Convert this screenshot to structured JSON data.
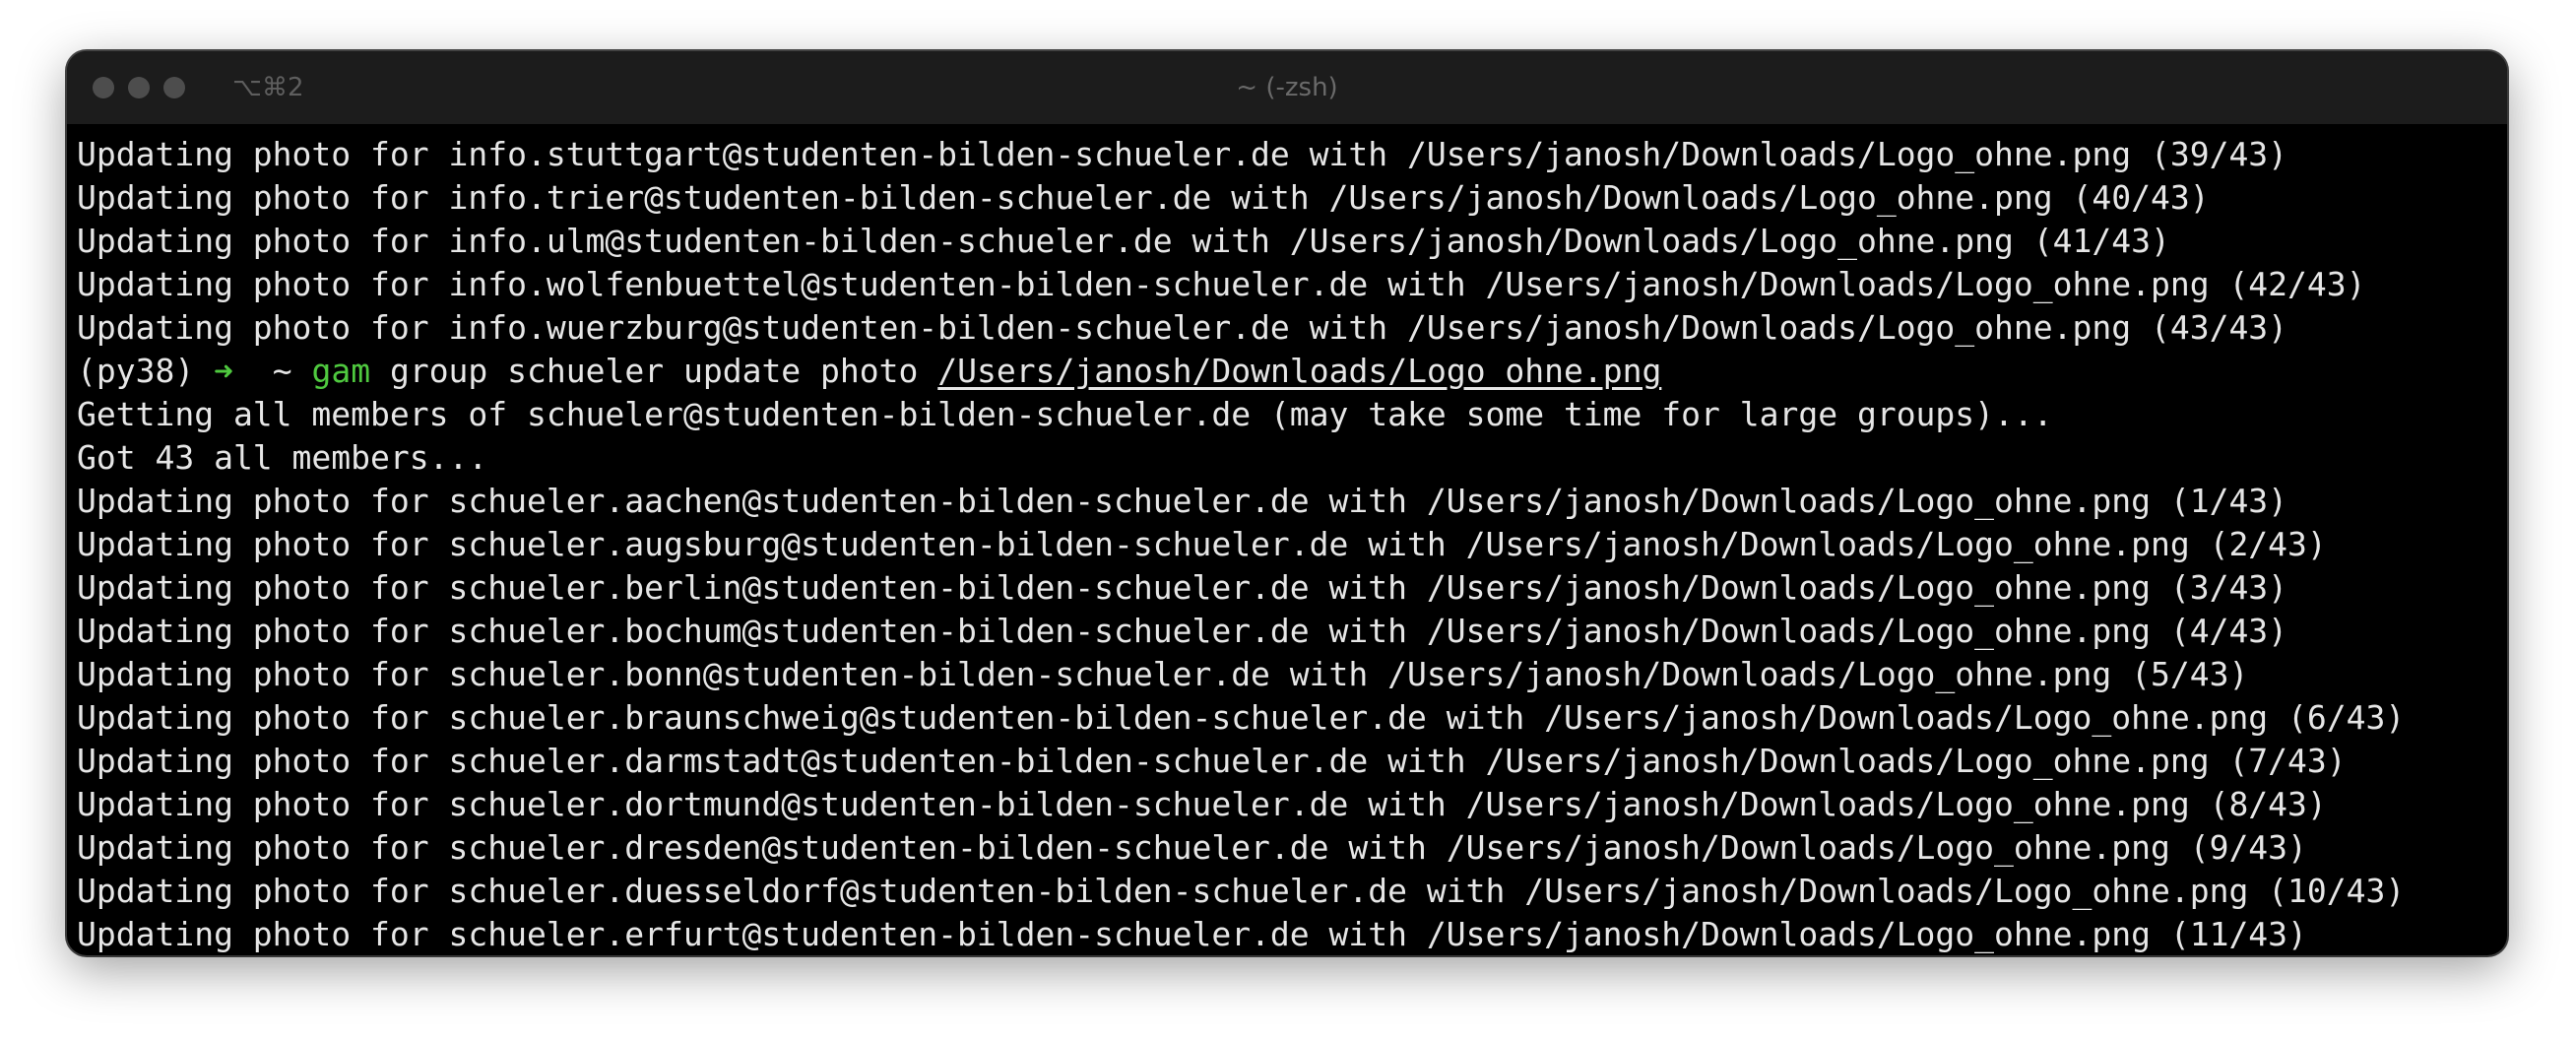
{
  "window": {
    "title": "~ (-zsh)",
    "shortcut": "⌥⌘2"
  },
  "terminal": {
    "lines_before": [
      "Updating photo for info.stuttgart@studenten-bilden-schueler.de with /Users/janosh/Downloads/Logo_ohne.png (39/43)",
      "Updating photo for info.trier@studenten-bilden-schueler.de with /Users/janosh/Downloads/Logo_ohne.png (40/43)",
      "Updating photo for info.ulm@studenten-bilden-schueler.de with /Users/janosh/Downloads/Logo_ohne.png (41/43)",
      "Updating photo for info.wolfenbuettel@studenten-bilden-schueler.de with /Users/janosh/Downloads/Logo_ohne.png (42/43)",
      "Updating photo for info.wuerzburg@studenten-bilden-schueler.de with /Users/janosh/Downloads/Logo_ohne.png (43/43)"
    ],
    "prompt": {
      "env": "(py38)",
      "arrow": "➜",
      "dir": "~",
      "command": "gam",
      "args": "group schueler update photo",
      "path_arg": "/Users/janosh/Downloads/Logo_ohne.png"
    },
    "lines_after": [
      "Getting all members of schueler@studenten-bilden-schueler.de (may take some time for large groups)...",
      "Got 43 all members...",
      "Updating photo for schueler.aachen@studenten-bilden-schueler.de with /Users/janosh/Downloads/Logo_ohne.png (1/43)",
      "Updating photo for schueler.augsburg@studenten-bilden-schueler.de with /Users/janosh/Downloads/Logo_ohne.png (2/43)",
      "Updating photo for schueler.berlin@studenten-bilden-schueler.de with /Users/janosh/Downloads/Logo_ohne.png (3/43)",
      "Updating photo for schueler.bochum@studenten-bilden-schueler.de with /Users/janosh/Downloads/Logo_ohne.png (4/43)",
      "Updating photo for schueler.bonn@studenten-bilden-schueler.de with /Users/janosh/Downloads/Logo_ohne.png (5/43)",
      "Updating photo for schueler.braunschweig@studenten-bilden-schueler.de with /Users/janosh/Downloads/Logo_ohne.png (6/43)",
      "Updating photo for schueler.darmstadt@studenten-bilden-schueler.de with /Users/janosh/Downloads/Logo_ohne.png (7/43)",
      "Updating photo for schueler.dortmund@studenten-bilden-schueler.de with /Users/janosh/Downloads/Logo_ohne.png (8/43)",
      "Updating photo for schueler.dresden@studenten-bilden-schueler.de with /Users/janosh/Downloads/Logo_ohne.png (9/43)",
      "Updating photo for schueler.duesseldorf@studenten-bilden-schueler.de with /Users/janosh/Downloads/Logo_ohne.png (10/43)",
      "Updating photo for schueler.erfurt@studenten-bilden-schueler.de with /Users/janosh/Downloads/Logo_ohne.png (11/43)"
    ]
  },
  "colors": {
    "background": "#000000",
    "text": "#e6e6e6",
    "prompt_accent": "#4fc93f",
    "titlebar": "#1c1c1c"
  }
}
